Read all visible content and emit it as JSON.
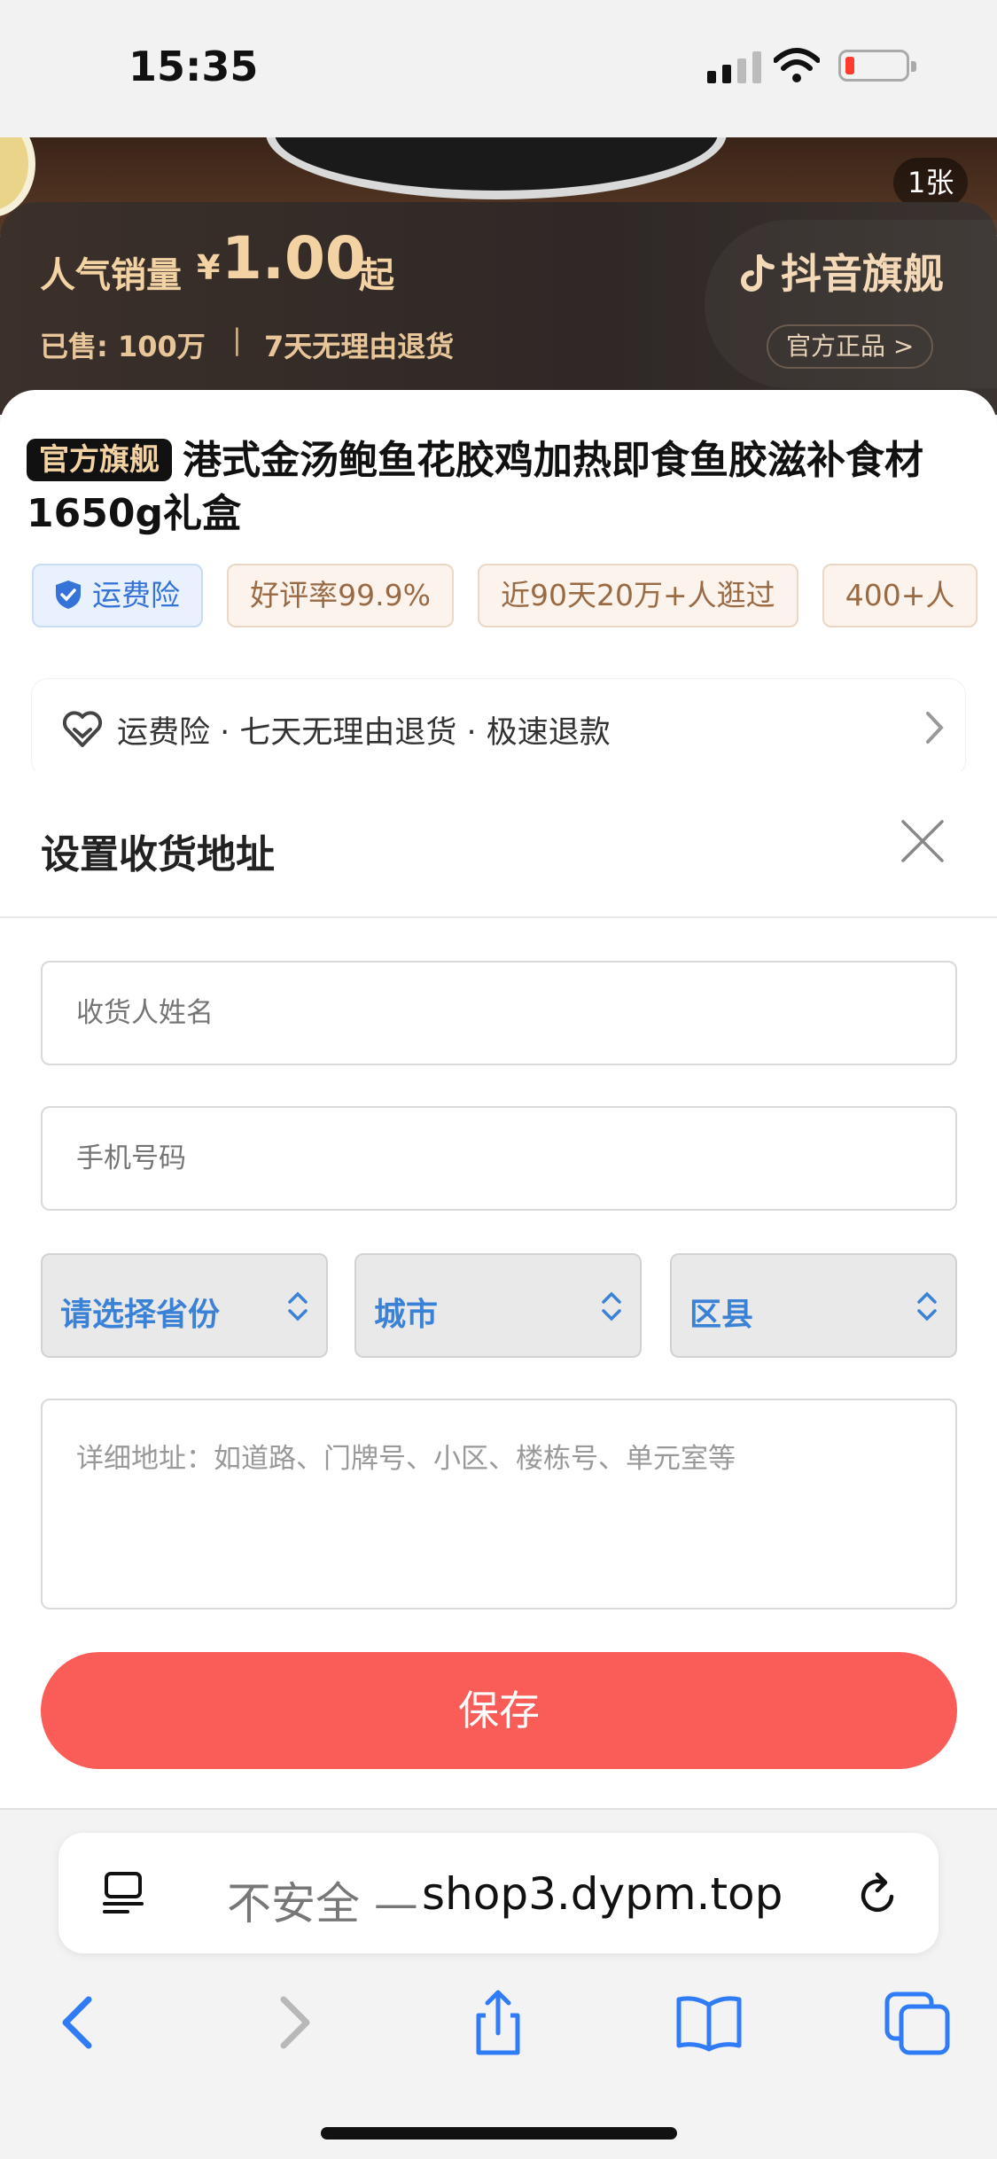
{
  "status_bar": {
    "time": "15:35"
  },
  "hero": {
    "image_count": "1张"
  },
  "price_band": {
    "label": "人气销量",
    "currency": "¥",
    "price": "1.00",
    "suffix": "起",
    "sold": "已售: 100万",
    "separator": "|",
    "returns": "7天无理由退货",
    "brand": "抖音旗舰",
    "official_button": "官方正品 >"
  },
  "product": {
    "tag": "官方旗舰",
    "title": "港式金汤鲍鱼花胶鸡加热即食鱼胶滋补食材1650g礼盒"
  },
  "chips": [
    {
      "label": "运费险"
    },
    {
      "label": "好评率99.9%"
    },
    {
      "label": "近90天20万+人逛过"
    },
    {
      "label": "400+人"
    }
  ],
  "service": {
    "text": "运费险 · 七天无理由退货 · 极速退款"
  },
  "address_modal": {
    "title": "设置收货地址",
    "name_placeholder": "收货人姓名",
    "phone_placeholder": "手机号码",
    "province": "请选择省份",
    "city": "城市",
    "district": "区县",
    "detail_placeholder": "详细地址：如道路、门牌号、小区、楼栋号、单元室等",
    "save_label": "保存"
  },
  "browser": {
    "insecure_label": "不安全 —",
    "host": "shop3.dypm.top"
  },
  "colors": {
    "accent_red": "#fa5d58",
    "select_blue": "#3b82d6",
    "gold": "#f3d2a4",
    "ios_blue": "#2f7cf6"
  }
}
